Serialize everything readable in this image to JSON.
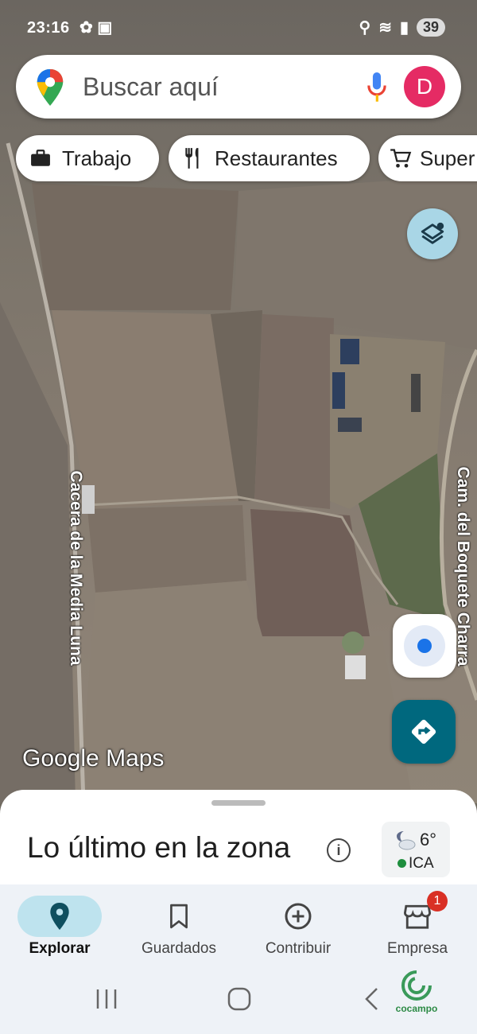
{
  "status_bar": {
    "time": "23:16",
    "battery": "39"
  },
  "search": {
    "placeholder": "Buscar aquí",
    "avatar_letter": "D"
  },
  "chips": [
    {
      "label": "Trabajo",
      "icon": "briefcase-icon"
    },
    {
      "label": "Restaurantes",
      "icon": "fork-knife-icon"
    },
    {
      "label": "Super",
      "icon": "cart-icon"
    }
  ],
  "map": {
    "road_left": "Cacera de la Media Luna",
    "road_right": "Cam. del Boquete Charra",
    "watermark": "Google Maps"
  },
  "sheet": {
    "title": "Lo último en la zona",
    "weather": {
      "temp": "6°",
      "air_quality": "ICA"
    }
  },
  "bottom_nav": [
    {
      "label": "Explorar",
      "icon": "pin-icon",
      "active": true
    },
    {
      "label": "Guardados",
      "icon": "bookmark-icon"
    },
    {
      "label": "Contribuir",
      "icon": "plus-circle-icon"
    },
    {
      "label": "Empresa",
      "icon": "store-icon",
      "badge": "1"
    }
  ],
  "watermark_logo": "cocampo",
  "colors": {
    "accent": "#00687e",
    "avatar": "#e52b64",
    "nav_active": "#bee3ee",
    "badge": "#d93025"
  }
}
